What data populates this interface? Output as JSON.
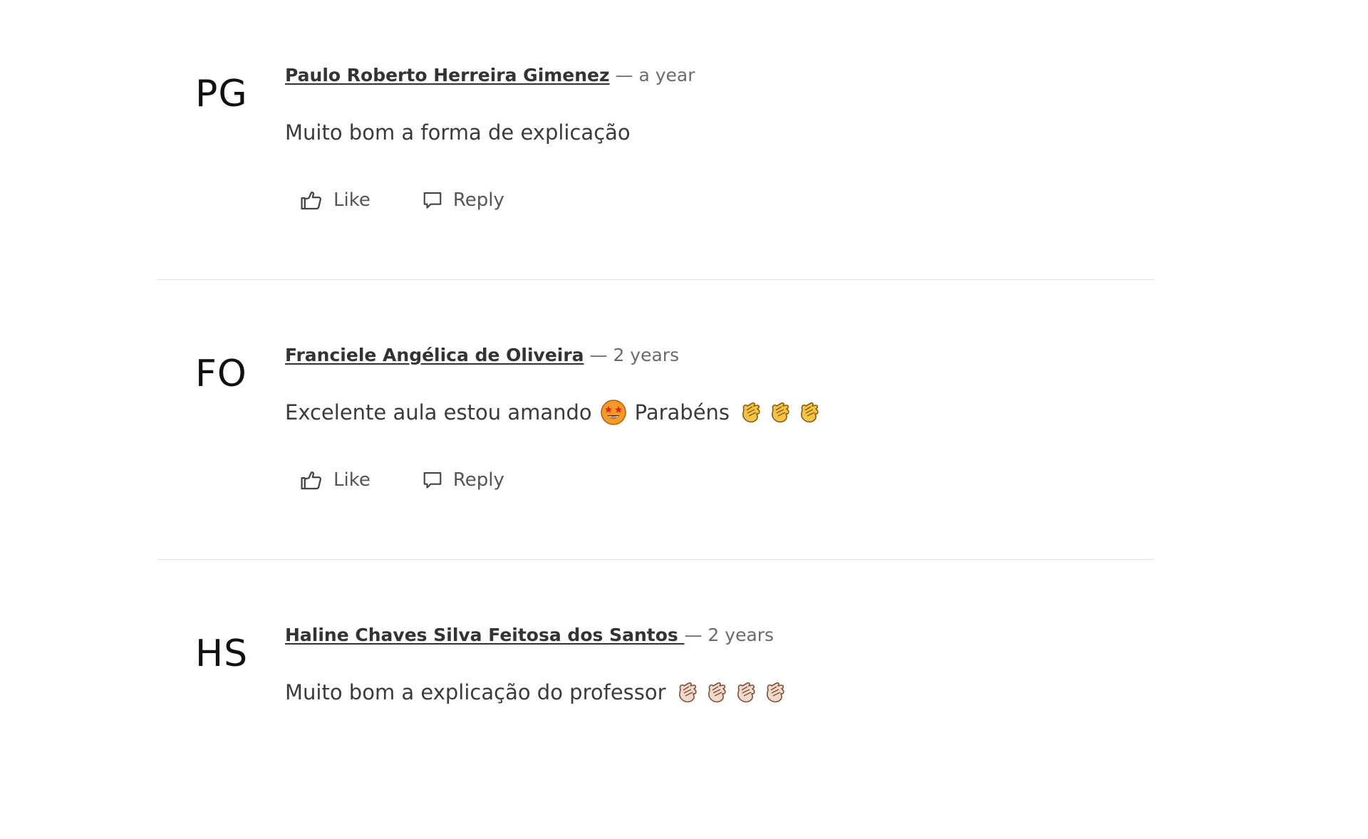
{
  "actions": {
    "like_label": "Like",
    "reply_label": "Reply"
  },
  "comments": [
    {
      "initials": "PG",
      "author": "Paulo Roberto Herreira Gimenez",
      "separator": "—",
      "time": "a year",
      "text": "Muito bom a forma de explicação"
    },
    {
      "initials": "FO",
      "author": "Franciele Angélica de Oliveira",
      "separator": "—",
      "time": "2 years",
      "text_part1": "Excelente aula estou amando",
      "text_part2": "Parabéns",
      "emoji_inline": "star-struck-face",
      "emoji_trailing": [
        "clapping-hands",
        "clapping-hands",
        "clapping-hands"
      ]
    },
    {
      "initials": "HS",
      "author": "Haline Chaves Silva Feitosa dos Santos ",
      "separator": "—",
      "time": "2 years",
      "text": "Muito bom a explicação do professor",
      "emoji_trailing": [
        "clapping-hands-light",
        "clapping-hands-light",
        "clapping-hands-light",
        "clapping-hands-light"
      ]
    }
  ],
  "colors": {
    "clap_yellow": "#f4c542",
    "clap_light": "#f3d9c7",
    "star_face": "#f59a26",
    "divider": "#e4e4e4"
  }
}
